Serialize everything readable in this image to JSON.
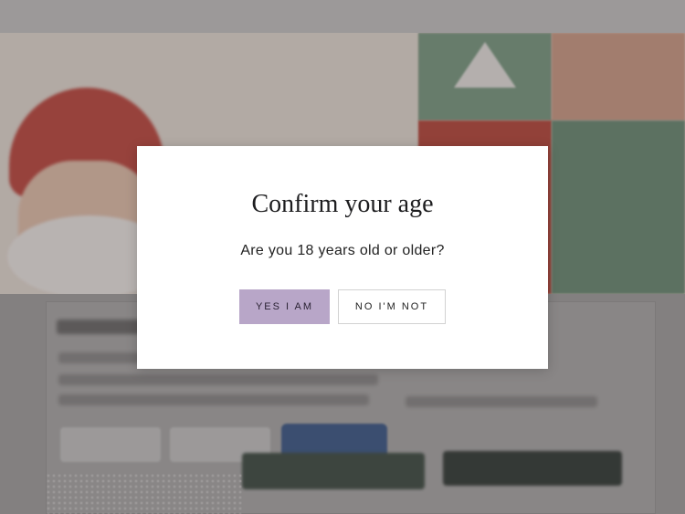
{
  "announcement": {
    "text": ""
  },
  "age_gate": {
    "title": "Confirm your age",
    "question": "Are you 18 years old or older?",
    "confirm_label": "YES I AM",
    "deny_label": "NO I'M NOT",
    "confirm_color": "#b8a6c8"
  },
  "background": {
    "overlay_color": "rgba(60,56,64,0.35)",
    "hero_accent": "#c45a3c",
    "hero_green": "#3d6a4a",
    "button_blue": "#3b5a8a",
    "button_dark": "#313932"
  }
}
